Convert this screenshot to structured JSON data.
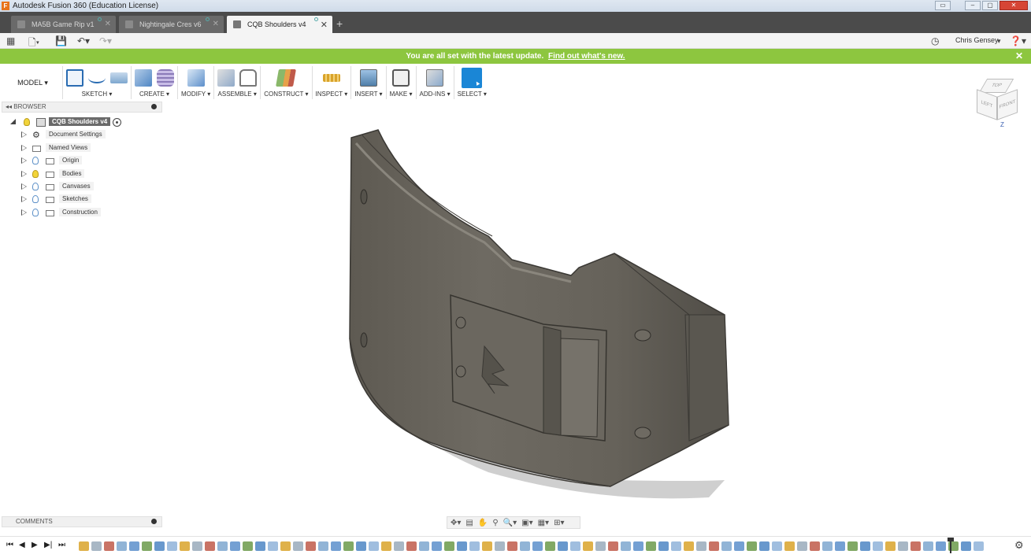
{
  "window": {
    "title": "Autodesk Fusion 360 (Education License)",
    "app_icon_letter": "F"
  },
  "tabs": [
    {
      "label": "MA5B Game Rip v1",
      "active": false
    },
    {
      "label": "Nightingale Cres v6",
      "active": false
    },
    {
      "label": "CQB Shoulders v4",
      "active": true
    }
  ],
  "quick_access": {
    "user_name": "Chris Gensey",
    "new_tab_symbol": "+"
  },
  "banner": {
    "message": "You are all set with the latest update.",
    "link": "Find out what's new.",
    "close_symbol": "✕",
    "color": "#8dc63f"
  },
  "toolbar": {
    "workspace": "MODEL ▾",
    "groups": [
      {
        "label": "SKETCH ▾"
      },
      {
        "label": "CREATE ▾"
      },
      {
        "label": "MODIFY ▾"
      },
      {
        "label": "ASSEMBLE ▾"
      },
      {
        "label": "CONSTRUCT ▾"
      },
      {
        "label": "INSPECT ▾"
      },
      {
        "label": "INSERT ▾"
      },
      {
        "label": "MAKE ▾"
      },
      {
        "label": "ADD-INS ▾"
      },
      {
        "label": "SELECT ▾"
      }
    ]
  },
  "browser": {
    "header": "BROWSER",
    "root": "CQB Shoulders v4",
    "items": [
      {
        "label": "Document Settings",
        "icon": "gear-icon"
      },
      {
        "label": "Named Views",
        "icon": "folder-icon"
      },
      {
        "label": "Origin",
        "icon": "folder-icon",
        "visible_bulb": false
      },
      {
        "label": "Bodies",
        "icon": "folder-icon",
        "visible_bulb": true
      },
      {
        "label": "Canvases",
        "icon": "folder-icon",
        "visible_bulb": false
      },
      {
        "label": "Sketches",
        "icon": "folder-icon",
        "visible_bulb": false
      },
      {
        "label": "Construction",
        "icon": "folder-icon",
        "visible_bulb": false
      }
    ]
  },
  "viewcube": {
    "top": "TOP",
    "left": "LEFT",
    "front": "FRONT",
    "z_axis": "Z"
  },
  "comments": {
    "header": "COMMENTS"
  },
  "timeline": {
    "controls": [
      "⏮",
      "◀",
      "▶",
      "▶|",
      "⏭"
    ],
    "feature_count": 72,
    "accent": "#d9a32a"
  }
}
